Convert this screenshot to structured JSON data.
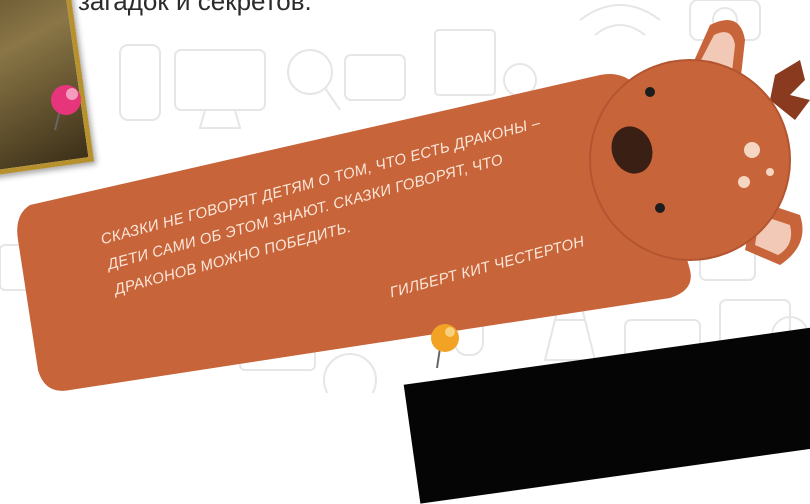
{
  "top_text": "загадок и секретов.",
  "quote": {
    "lines": [
      "Сказки не говорят детям о том, что есть драконы –",
      "дети сами об этом знают. Сказки говорят, что",
      "драконов можно победить."
    ],
    "author": "Гилберт Кит Честертон"
  },
  "colors": {
    "bookmark": "#c8643a",
    "pin_pink": "#e6357a",
    "pin_yellow": "#f2a324",
    "text_light": "#fbe7d9"
  }
}
